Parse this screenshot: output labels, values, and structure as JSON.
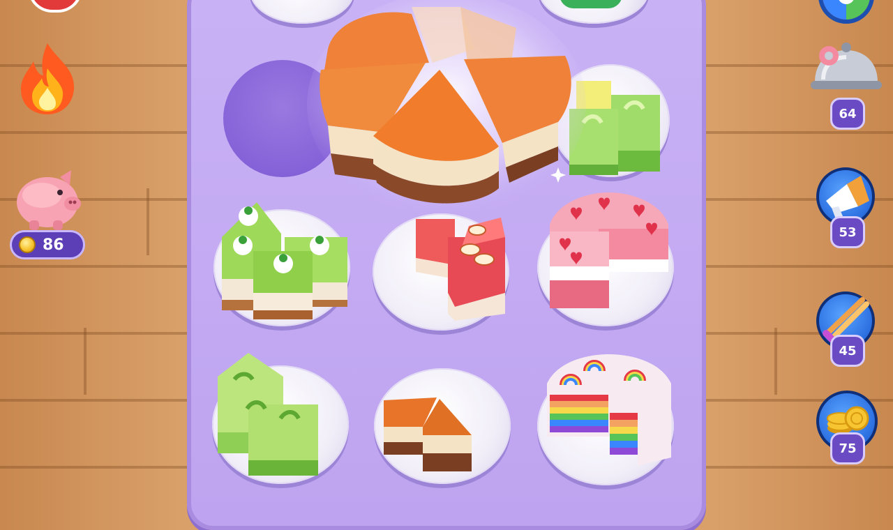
{
  "hud": {
    "coins": "86"
  },
  "boosters": [
    {
      "name": "serving-dome",
      "count": "64"
    },
    {
      "name": "megaphone",
      "count": "53"
    },
    {
      "name": "tongs",
      "count": "45"
    },
    {
      "name": "coins-stack",
      "count": "75"
    }
  ],
  "colors": {
    "board": "#c9b2f5",
    "badge": "#6a4bc4",
    "orange_cake": "#e8742a",
    "green_cake": "#9bd45a",
    "pink_cake": "#f07a8a",
    "rainbow_cake": "#f6e6ee"
  },
  "icons": [
    "fire-icon",
    "piggy-bank-icon",
    "coin-icon",
    "serving-dome-icon",
    "megaphone-icon",
    "tongs-icon",
    "coins-stack-icon",
    "color-wheel-icon"
  ]
}
